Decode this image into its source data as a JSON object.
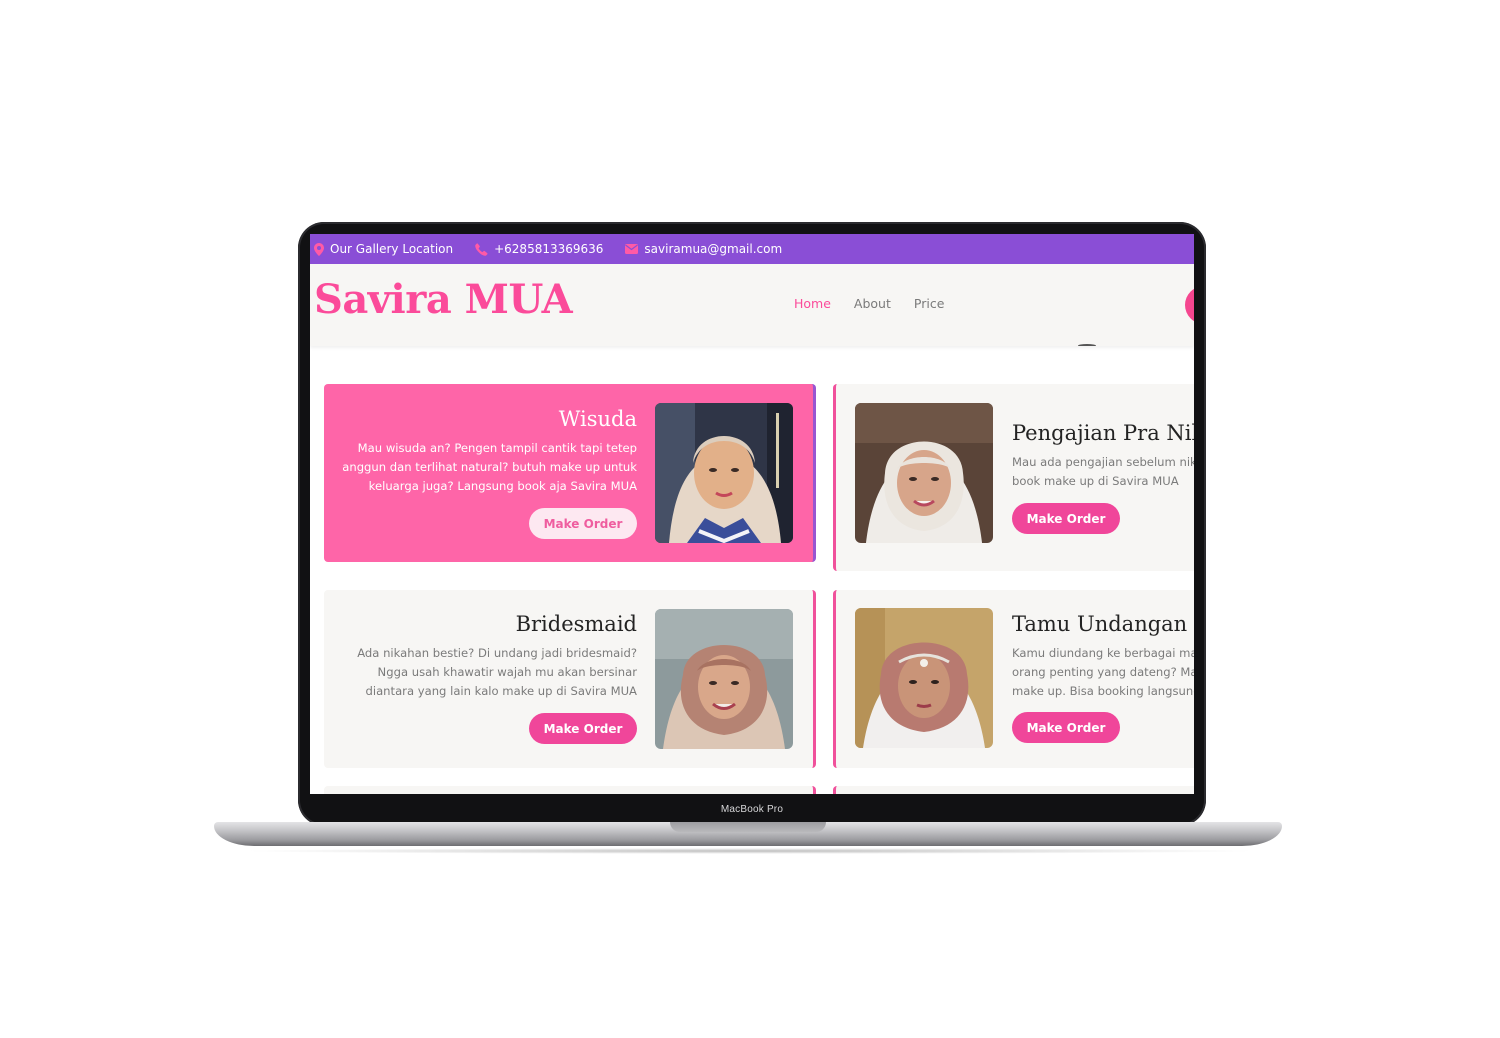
{
  "device": {
    "label": "MacBook Pro"
  },
  "topbar": {
    "location": "Our Gallery Location",
    "phone": "+6285813369636",
    "email": "saviramua@gmail.com"
  },
  "header": {
    "brand": "Savira MUA",
    "nav": [
      {
        "label": "Home",
        "active": true
      },
      {
        "label": "About",
        "active": false
      },
      {
        "label": "Price",
        "active": false
      }
    ]
  },
  "services": [
    {
      "title": "Wisuda",
      "desc_lines": [
        "Mau wisuda an? Pengen tampil cantik tapi tetep",
        "anggun dan terlihat natural? butuh make up untuk",
        "keluarga juga? Langsung book aja Savira MUA"
      ],
      "button": "Make Order"
    },
    {
      "title": "Pengajian Pra Nika",
      "desc_lines": [
        "Mau ada pengajian sebelum nik",
        "book make up di Savira MUA"
      ],
      "button": "Make Order"
    },
    {
      "title": "Bridesmaid",
      "desc_lines": [
        "Ada nikahan bestie? Di undang jadi bridesmaid?",
        "Ngga usah khawatir wajah mu akan bersinar",
        "diantara yang lain kalo make up di Savira MUA"
      ],
      "button": "Make Order"
    },
    {
      "title": "Tamu Undangan",
      "desc_lines": [
        "Kamu diundang ke berbagai ma",
        "orang penting yang dateng? Ma",
        "make up. Bisa booking langsung"
      ],
      "button": "Make Order"
    }
  ],
  "colors": {
    "accent_pink": "#fb4b9a",
    "topbar_purple": "#8a4ed6",
    "card_pink": "#fe65a8",
    "card_bg": "#f7f6f4"
  },
  "icons": [
    "map-pin-icon",
    "phone-icon",
    "mail-icon"
  ]
}
